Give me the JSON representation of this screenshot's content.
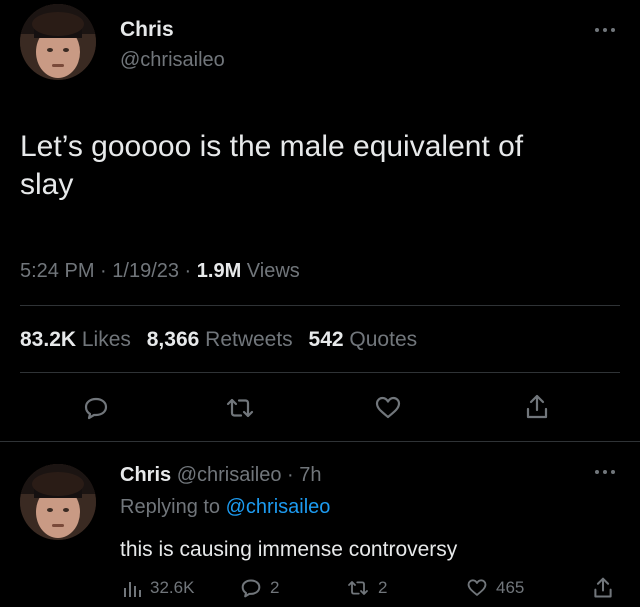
{
  "tweet": {
    "author_name": "Chris",
    "author_handle": "@chrisaileo",
    "more_icon": "ellipsis-icon",
    "text_line1": "Let’s gooooo is the male equivalent of",
    "text_line2": "slay",
    "time": "5:24 PM",
    "sep1": " · ",
    "date": "1/19/23",
    "sep2": " · ",
    "views_count": "1.9M",
    "views_label": " Views",
    "likes_count": "83.2K",
    "likes_label": " Likes",
    "retweets_count": "8,366",
    "retweets_label": " Retweets",
    "quotes_count": "542",
    "quotes_label": " Quotes",
    "actions": [
      "reply-icon",
      "retweet-icon",
      "like-icon",
      "share-icon"
    ]
  },
  "reply": {
    "author_name": "Chris",
    "author_handle": "@chrisaileo",
    "sep": " · ",
    "time": "7h",
    "replying_prefix": "Replying to ",
    "replying_handle": "@chrisaileo",
    "text": "this is causing immense controversy",
    "views": "32.6K",
    "replies": "2",
    "retweets": "2",
    "likes": "465"
  },
  "colors": {
    "background": "#000000",
    "text": "#e7e9ea",
    "secondary": "#71767b",
    "link": "#1d9bf0",
    "divider": "#2f3336"
  }
}
